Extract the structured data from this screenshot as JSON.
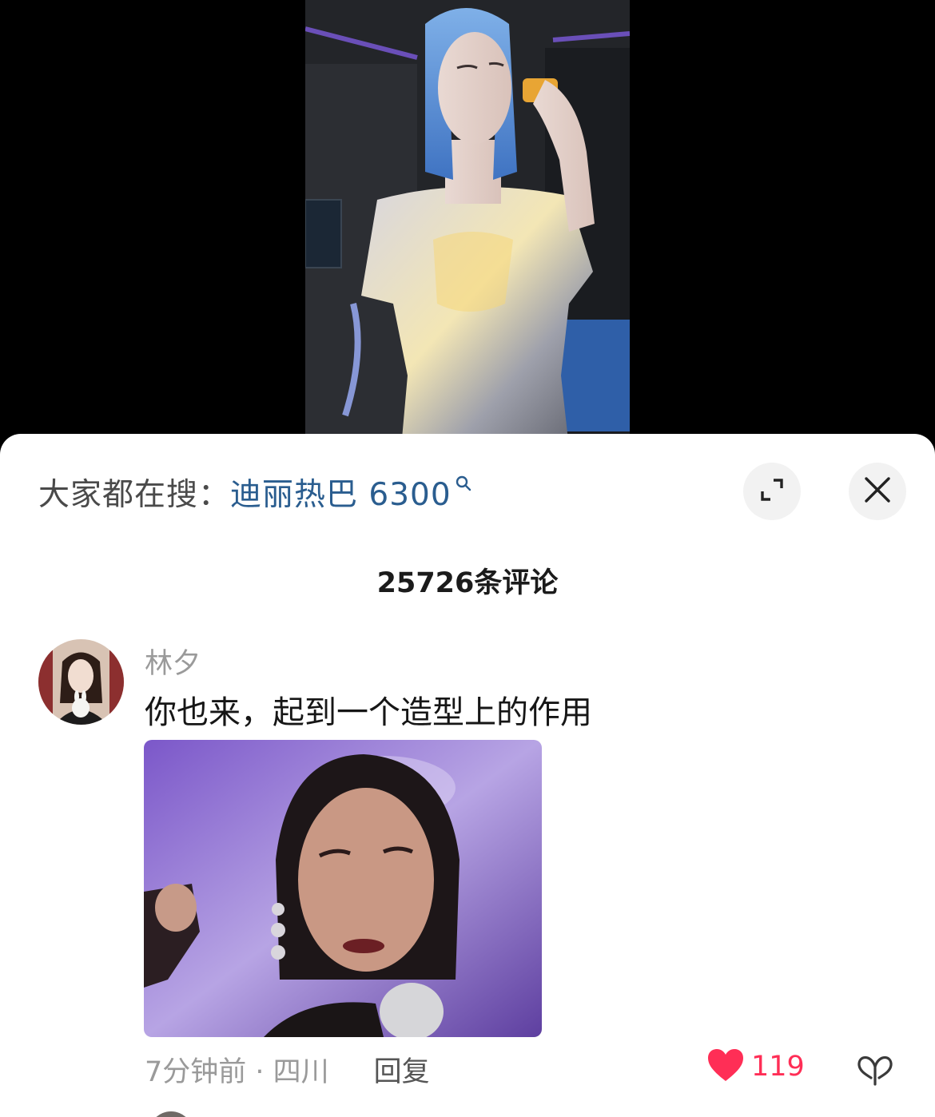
{
  "search": {
    "prefix": "大家都在搜：",
    "term": "迪丽热巴 6300"
  },
  "comments": {
    "count_label": "25726条评论",
    "items": [
      {
        "username": "林夕",
        "text": "你也来，起到一个造型上的作用",
        "meta": "7分钟前 · 四川",
        "reply_label": "回复",
        "likes": "119"
      }
    ]
  },
  "icons": {
    "search": "search-icon",
    "expand": "expand-icon",
    "close": "close-icon",
    "like": "heart-icon",
    "dislike": "dislike-icon"
  },
  "colors": {
    "search_term": "#2a5d8f",
    "like": "#ff2e56",
    "text_primary": "#161616",
    "text_secondary": "#9a9a9a"
  }
}
